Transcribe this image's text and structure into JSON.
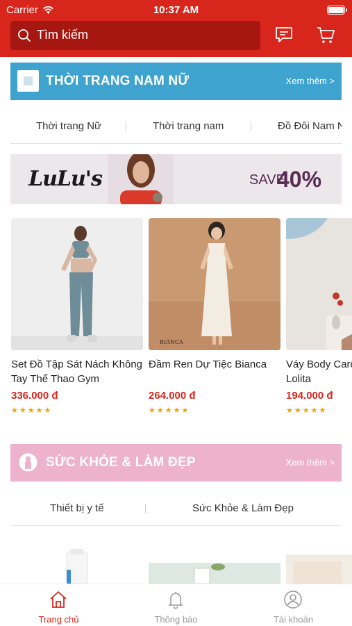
{
  "status_bar": {
    "carrier": "Carrier",
    "time": "10:37 AM"
  },
  "header": {
    "search_placeholder": "Tìm kiếm",
    "icons": [
      "search-icon",
      "chat-icon",
      "cart-icon"
    ],
    "color": "#d9261c"
  },
  "section_fashion": {
    "title": "THỜI TRANG NAM NỮ",
    "more": "Xem thêm >",
    "color": "#3ea3cf",
    "subcategories": [
      "Thời trang Nữ",
      "Thời trang nam",
      "Đồ Đôi Nam Nữ"
    ]
  },
  "promo_banner": {
    "brand": "LuLu's",
    "save_label": "SAVE",
    "discount": "40%"
  },
  "products": [
    {
      "name": "Set Đồ Tập Sát Nách Không Tay Thể Thao Gym",
      "price": "336.000 đ",
      "rating": 5
    },
    {
      "name": "Đầm Ren Dự Tiệc Bianca",
      "price": "264.000 đ",
      "rating": 5,
      "image_text": "BIANCA"
    },
    {
      "name": "Váy Body Carô Bèo Trắng Lolita",
      "price": "194.000 đ",
      "rating": 5
    }
  ],
  "section_health": {
    "title": "SỨC KHỎE & LÀM ĐẸP",
    "more": "Xem thêm >",
    "color": "#eeb3cc",
    "subcategories": [
      "Thiết bị y tế",
      "Sức Khỏe & Làm Đẹp"
    ]
  },
  "tabbar": {
    "items": [
      {
        "label": "Trang chủ",
        "icon": "home-icon",
        "active": true
      },
      {
        "label": "Thông báo",
        "icon": "bell-icon",
        "active": false
      },
      {
        "label": "Tài khoản",
        "icon": "user-icon",
        "active": false
      }
    ]
  }
}
